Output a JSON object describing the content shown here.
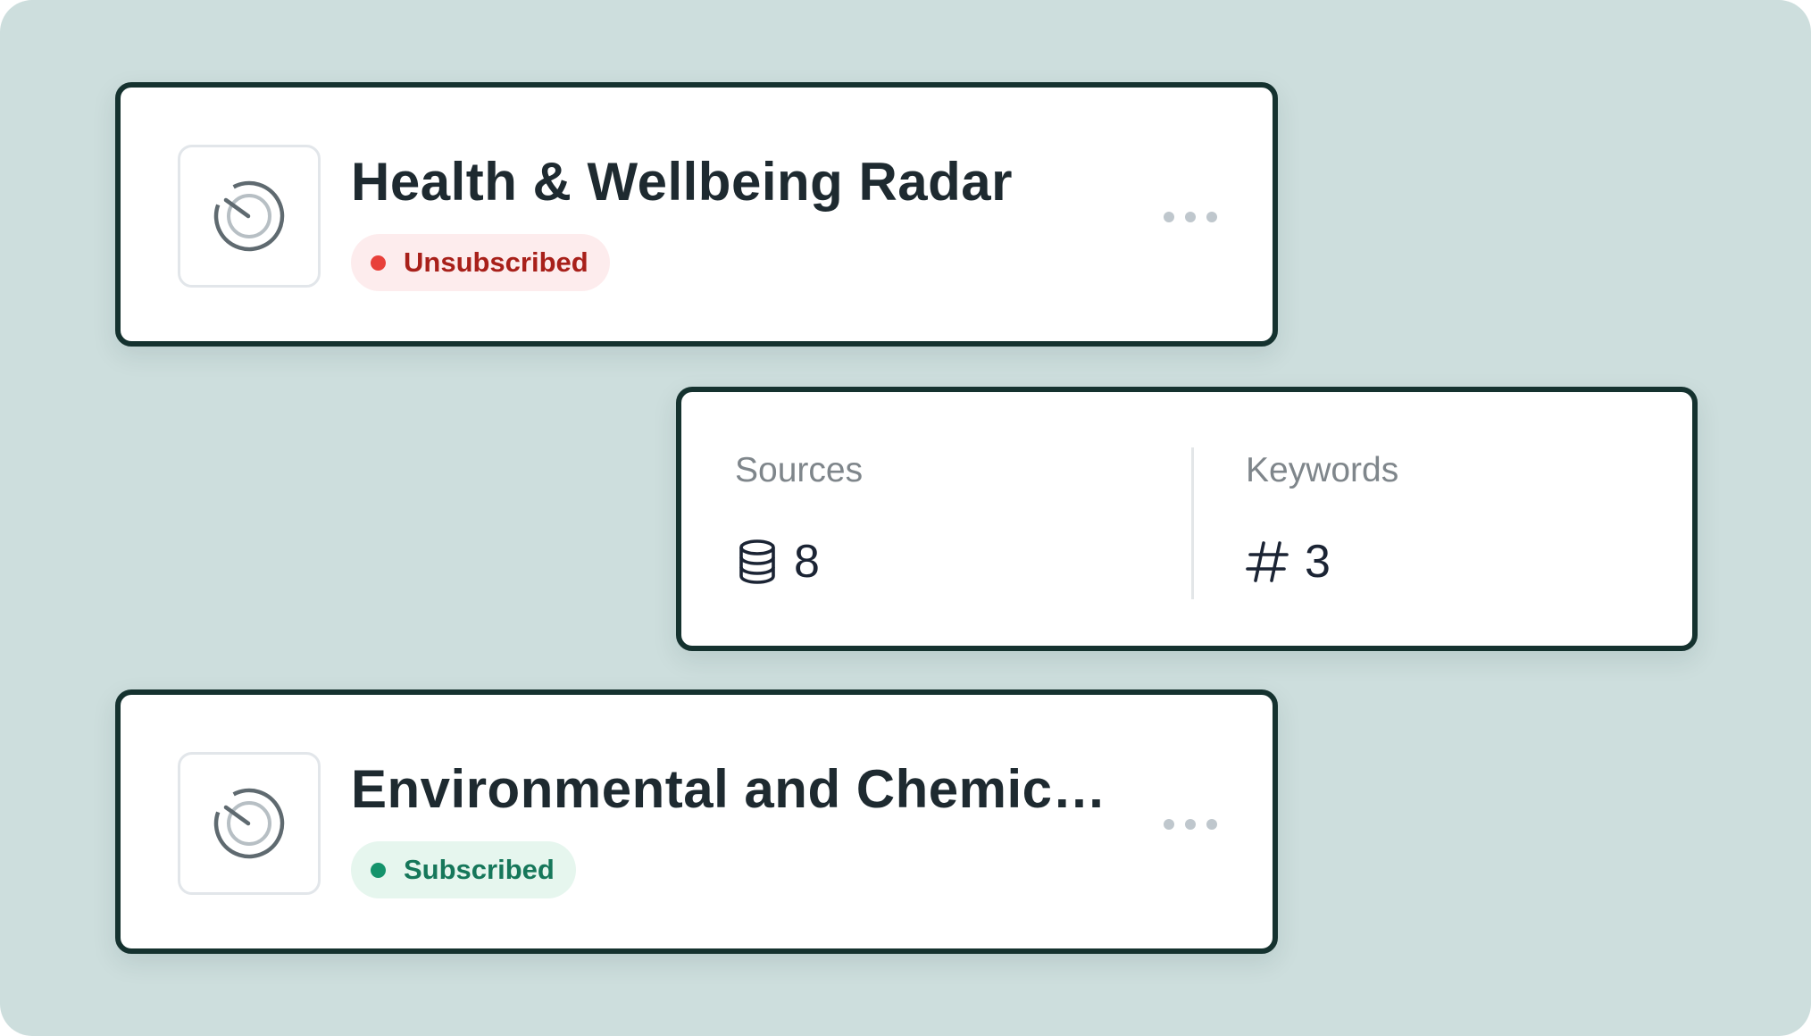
{
  "radars": [
    {
      "title": "Health & Wellbeing Radar",
      "status": "Unsubscribed",
      "status_color": "#e8403a",
      "icon": "radar-icon",
      "menu_icon": "more-horizontal-icon"
    },
    {
      "title": "Environmental and Chemica...",
      "status": "Subscribed",
      "status_color": "#14936b",
      "icon": "radar-icon",
      "menu_icon": "more-horizontal-icon"
    }
  ],
  "stats": {
    "sources": {
      "label": "Sources",
      "value": "8",
      "icon": "database-icon"
    },
    "keywords": {
      "label": "Keywords",
      "value": "3",
      "icon": "hash-icon"
    }
  },
  "colors": {
    "background": "#cddedd",
    "card_border": "#15322f",
    "title_text": "#1e2a30"
  }
}
